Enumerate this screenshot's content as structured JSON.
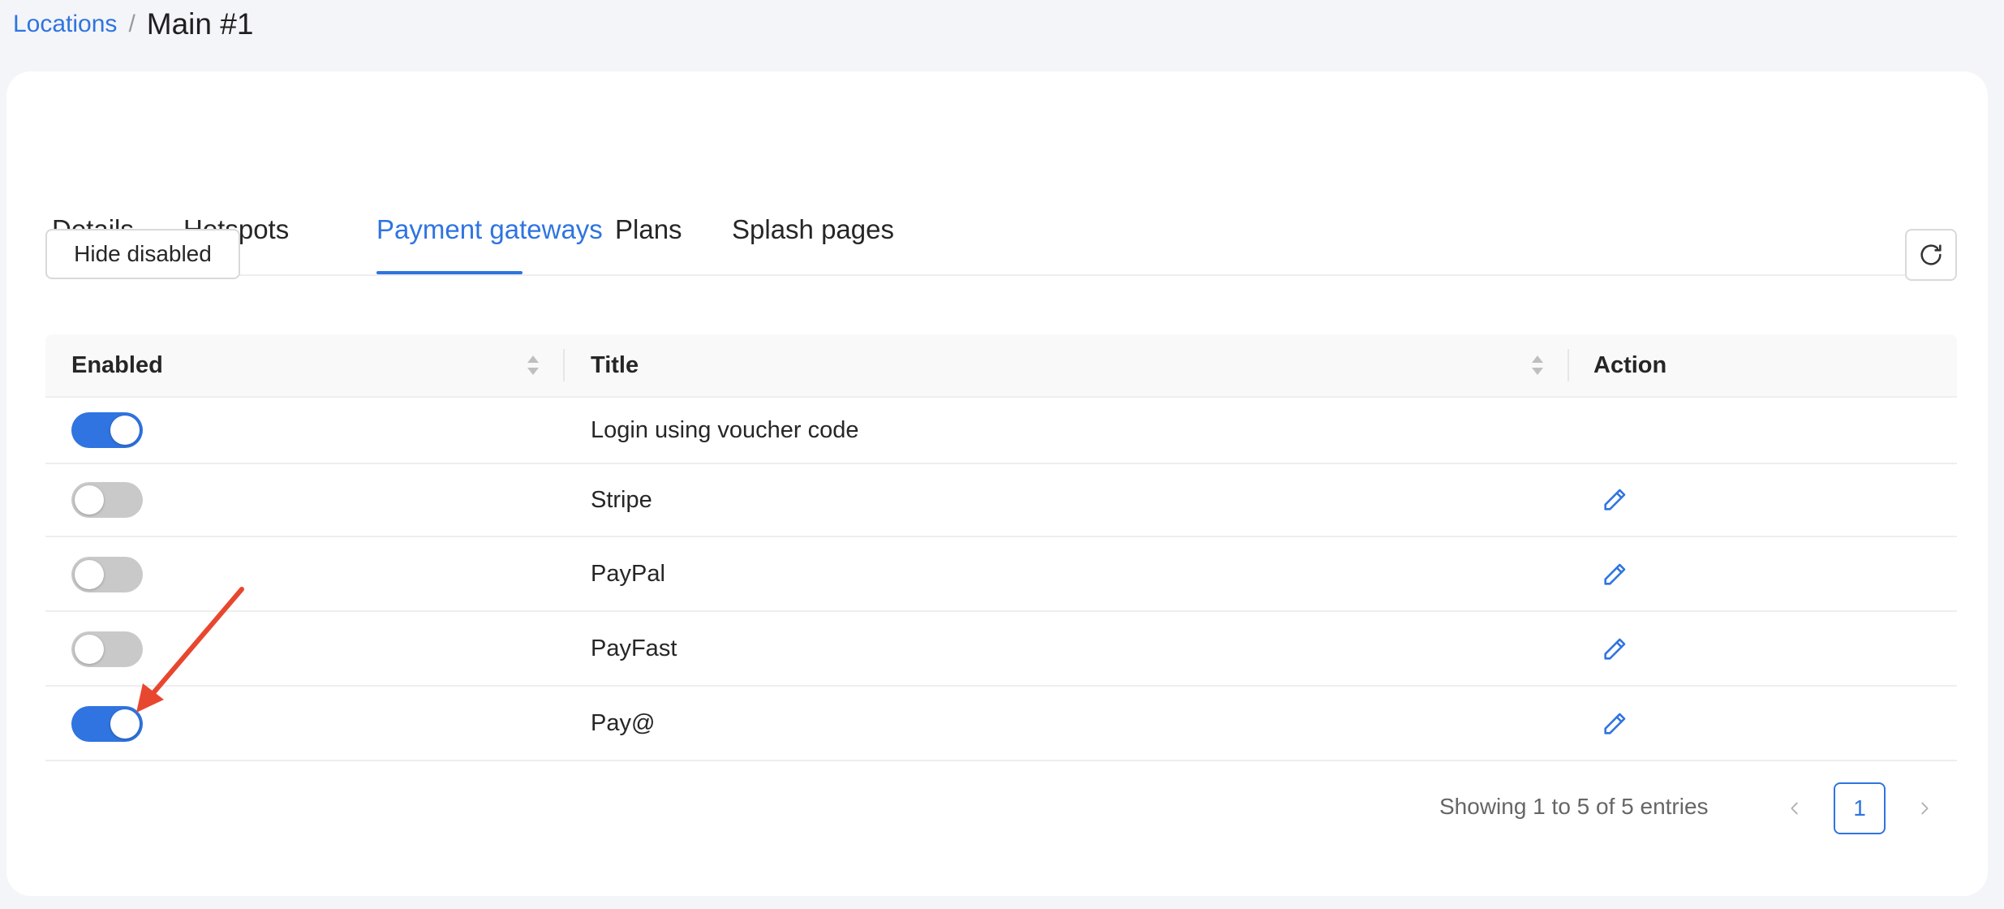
{
  "breadcrumb": {
    "parent": "Locations",
    "separator": "/",
    "current": "Main #1"
  },
  "tabs": [
    {
      "label": "Details",
      "active": false
    },
    {
      "label": "Hotspots",
      "active": false
    },
    {
      "label": "Payment gateways",
      "active": true
    },
    {
      "label": "Plans",
      "active": false
    },
    {
      "label": "Splash pages",
      "active": false
    }
  ],
  "toolbar": {
    "hide_disabled_label": "Hide disabled",
    "refresh_icon": "refresh-icon"
  },
  "table": {
    "columns": [
      "Enabled",
      "Title",
      "Action"
    ],
    "rows": [
      {
        "enabled": true,
        "title": "Login using voucher code",
        "editable": false
      },
      {
        "enabled": false,
        "title": "Stripe",
        "editable": true
      },
      {
        "enabled": false,
        "title": "PayPal",
        "editable": true
      },
      {
        "enabled": false,
        "title": "PayFast",
        "editable": true
      },
      {
        "enabled": true,
        "title": "Pay@",
        "editable": true
      }
    ]
  },
  "pagination": {
    "info": "Showing 1 to 5 of 5 entries",
    "current_page": "1"
  },
  "colors": {
    "accent": "#2f74e0",
    "annotation_arrow": "#e8472f"
  }
}
